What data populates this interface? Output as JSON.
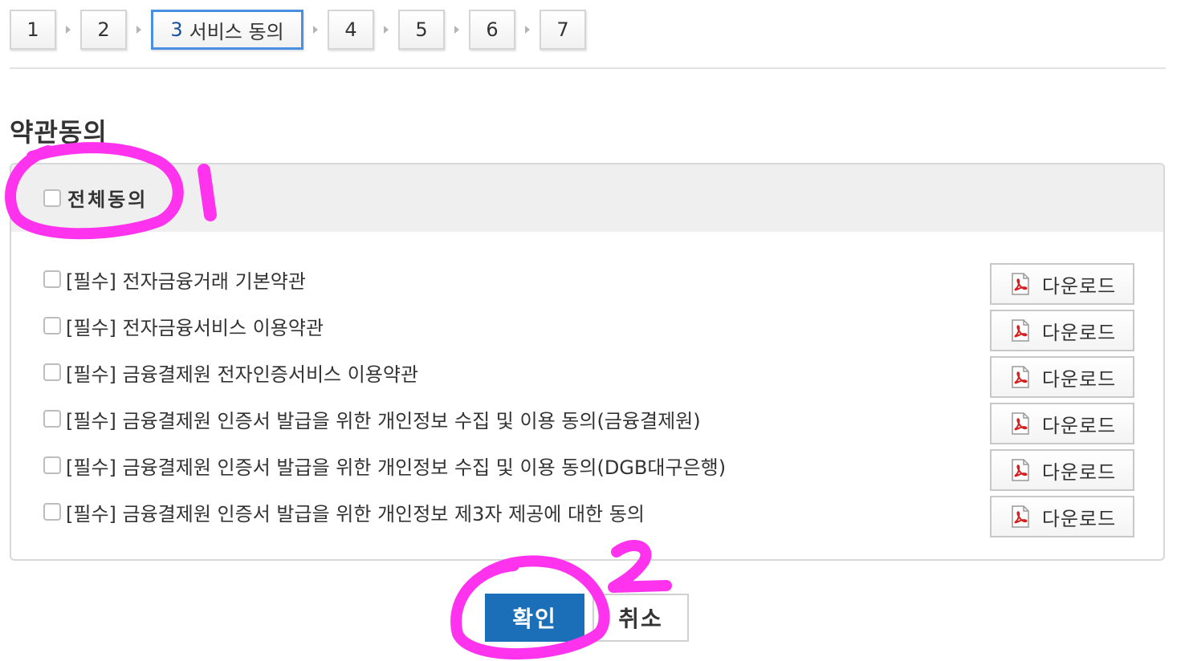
{
  "steps": [
    {
      "number": "1"
    },
    {
      "number": "2"
    },
    {
      "number": "3",
      "label": "서비스 동의",
      "active": true
    },
    {
      "number": "4"
    },
    {
      "number": "5"
    },
    {
      "number": "6"
    },
    {
      "number": "7"
    }
  ],
  "section_title": "약관동의",
  "agree_all": {
    "label": "전체동의",
    "checked": false
  },
  "terms": [
    {
      "label": "[필수] 전자금융거래 기본약관",
      "checked": false,
      "download_label": "다운로드"
    },
    {
      "label": "[필수] 전자금융서비스 이용약관",
      "checked": false,
      "download_label": "다운로드"
    },
    {
      "label": "[필수] 금융결제원 전자인증서비스 이용약관",
      "checked": false,
      "download_label": "다운로드"
    },
    {
      "label": "[필수] 금융결제원 인증서 발급을 위한 개인정보 수집 및 이용 동의(금융결제원)",
      "checked": false,
      "download_label": "다운로드"
    },
    {
      "label": "[필수] 금융결제원 인증서 발급을 위한 개인정보 수집 및 이용 동의(DGB대구은행)",
      "checked": false,
      "download_label": "다운로드"
    },
    {
      "label": "[필수] 금융결제원 인증서 발급을 위한 개인정보 제3자 제공에 대한 동의",
      "checked": false,
      "download_label": "다운로드"
    }
  ],
  "buttons": {
    "confirm": "확인",
    "cancel": "취소"
  },
  "colors": {
    "active_step_border": "#4a90e2",
    "confirm_bg": "#1a6fb8",
    "annotation": "#ff33ee"
  },
  "icons": {
    "download": "pdf-icon"
  }
}
